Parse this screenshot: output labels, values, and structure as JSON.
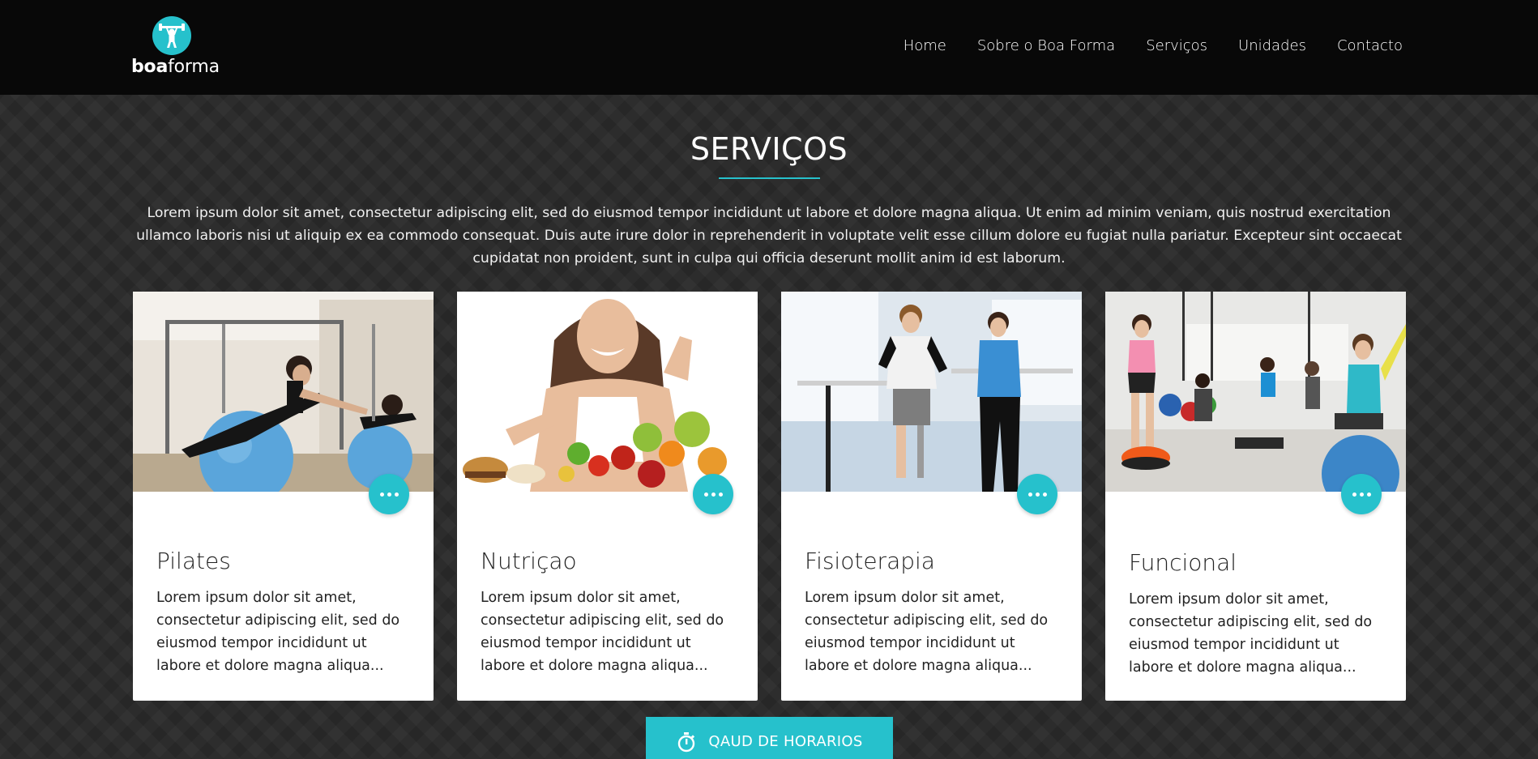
{
  "brand": {
    "bold": "boa",
    "light": "forma",
    "accent": "#26c1cc"
  },
  "nav": {
    "items": [
      {
        "label": "Home"
      },
      {
        "label": "Sobre o Boa Forma"
      },
      {
        "label": "Serviços"
      },
      {
        "label": "Unidades"
      },
      {
        "label": "Contacto"
      }
    ]
  },
  "section": {
    "title": "SERVIÇOS",
    "intro": "Lorem ipsum dolor sit amet, consectetur adipiscing elit, sed do eiusmod tempor incididunt ut labore et dolore magna aliqua. Ut enim ad minim veniam, quis nostrud exercitation ullamco laboris nisi ut aliquip ex ea commodo consequat. Duis aute irure dolor in reprehenderit in voluptate velit esse cillum dolore eu fugiat nulla pariatur. Excepteur sint occaecat cupidatat non proident, sunt in culpa qui officia deserunt mollit anim id est laborum."
  },
  "cards": [
    {
      "title": "Pilates",
      "text": "Lorem ipsum dolor sit amet, consectetur adipiscing elit, sed do eiusmod tempor incididunt ut labore et dolore magna aliqua...",
      "more_icon": "more-horizontal-icon"
    },
    {
      "title": "Nutriçao",
      "text": "Lorem ipsum dolor sit amet, consectetur adipiscing elit, sed do eiusmod tempor incididunt ut labore et dolore magna aliqua...",
      "more_icon": "more-horizontal-icon"
    },
    {
      "title": "Fisioterapia",
      "text": "Lorem ipsum dolor sit amet, consectetur adipiscing elit, sed do eiusmod tempor incididunt ut labore et dolore magna aliqua...",
      "more_icon": "more-horizontal-icon"
    },
    {
      "title": "Funcional",
      "text": "Lorem ipsum dolor sit amet, consectetur adipiscing elit, sed do eiusmod tempor incididunt ut labore et dolore magna aliqua...",
      "more_icon": "more-horizontal-icon"
    }
  ],
  "cta": {
    "label": "QAUD DE HORARIOS",
    "icon": "stopwatch-icon"
  }
}
